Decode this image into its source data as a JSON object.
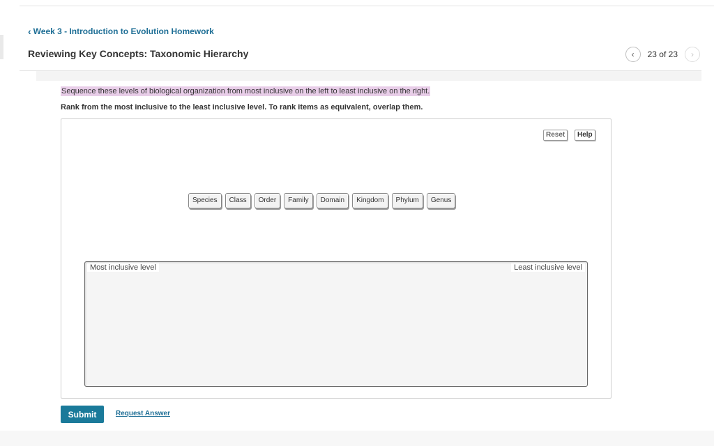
{
  "breadcrumb": {
    "chevron": "‹",
    "label": "Week 3 - Introduction to Evolution Homework"
  },
  "header": {
    "title": "Reviewing Key Concepts: Taxonomic Hierarchy"
  },
  "pager": {
    "prev_icon": "‹",
    "count": "23 of 23",
    "next_icon": "›"
  },
  "question": {
    "instruction": "Sequence these levels of biological organization from most inclusive on the left to least inclusive on the right.",
    "rank_hint": "Rank from the most inclusive to the least inclusive level. To rank items as equivalent, overlap them."
  },
  "tools": {
    "reset_label": "Reset",
    "help_label": "Help"
  },
  "items": [
    "Species",
    "Class",
    "Order",
    "Family",
    "Domain",
    "Kingdom",
    "Phylum",
    "Genus"
  ],
  "drop_zone": {
    "left_label": "Most inclusive level",
    "right_label": "Least inclusive level"
  },
  "actions": {
    "submit_label": "Submit",
    "request_answer_label": "Request Answer"
  },
  "colors": {
    "accent": "#1a7a9a",
    "link": "#1f6f96",
    "highlight": "#e8cde8"
  }
}
